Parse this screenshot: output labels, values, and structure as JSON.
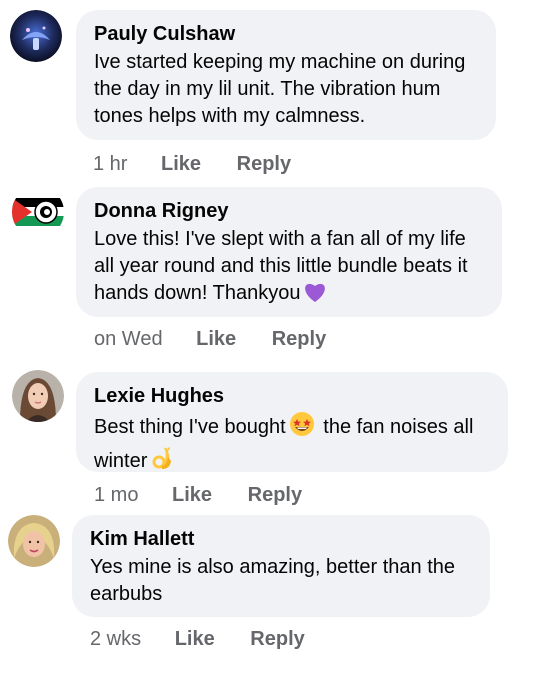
{
  "comments": [
    {
      "author": "Pauly Culshaw",
      "text": "Ive started keeping my machine on during the day in my lil unit. The vibration hum tones helps with my calmness.",
      "time": "1 hr",
      "like": "Like",
      "reply": "Reply"
    },
    {
      "author": "Donna Rigney",
      "text_line1": "Love this! I've slept with a fan all of my life",
      "text_line2": "all year round and this little bundle beats it",
      "text_line3": "hands down! Thankyou",
      "emoji": "purple-heart-icon",
      "time": "on Wed",
      "like": "Like",
      "reply": "Reply"
    },
    {
      "author": "Lexie Hughes",
      "text_part1": "Best thing I've bought",
      "emoji1": "star-struck-emoji-icon",
      "text_part2": "the fan noises all",
      "text_part3": "winter",
      "emoji2": "ok-hand-emoji-icon",
      "time": "1 mo",
      "like": "Like",
      "reply": "Reply"
    },
    {
      "author": "Kim Hallett",
      "text": "Yes mine is also amazing, better than the earbubs",
      "time": "2 wks",
      "like": "Like",
      "reply": "Reply"
    }
  ],
  "colors": {
    "bubble": "#f0f2f5",
    "meta": "#65676b",
    "text": "#050505",
    "heart": "#9b59d6"
  }
}
